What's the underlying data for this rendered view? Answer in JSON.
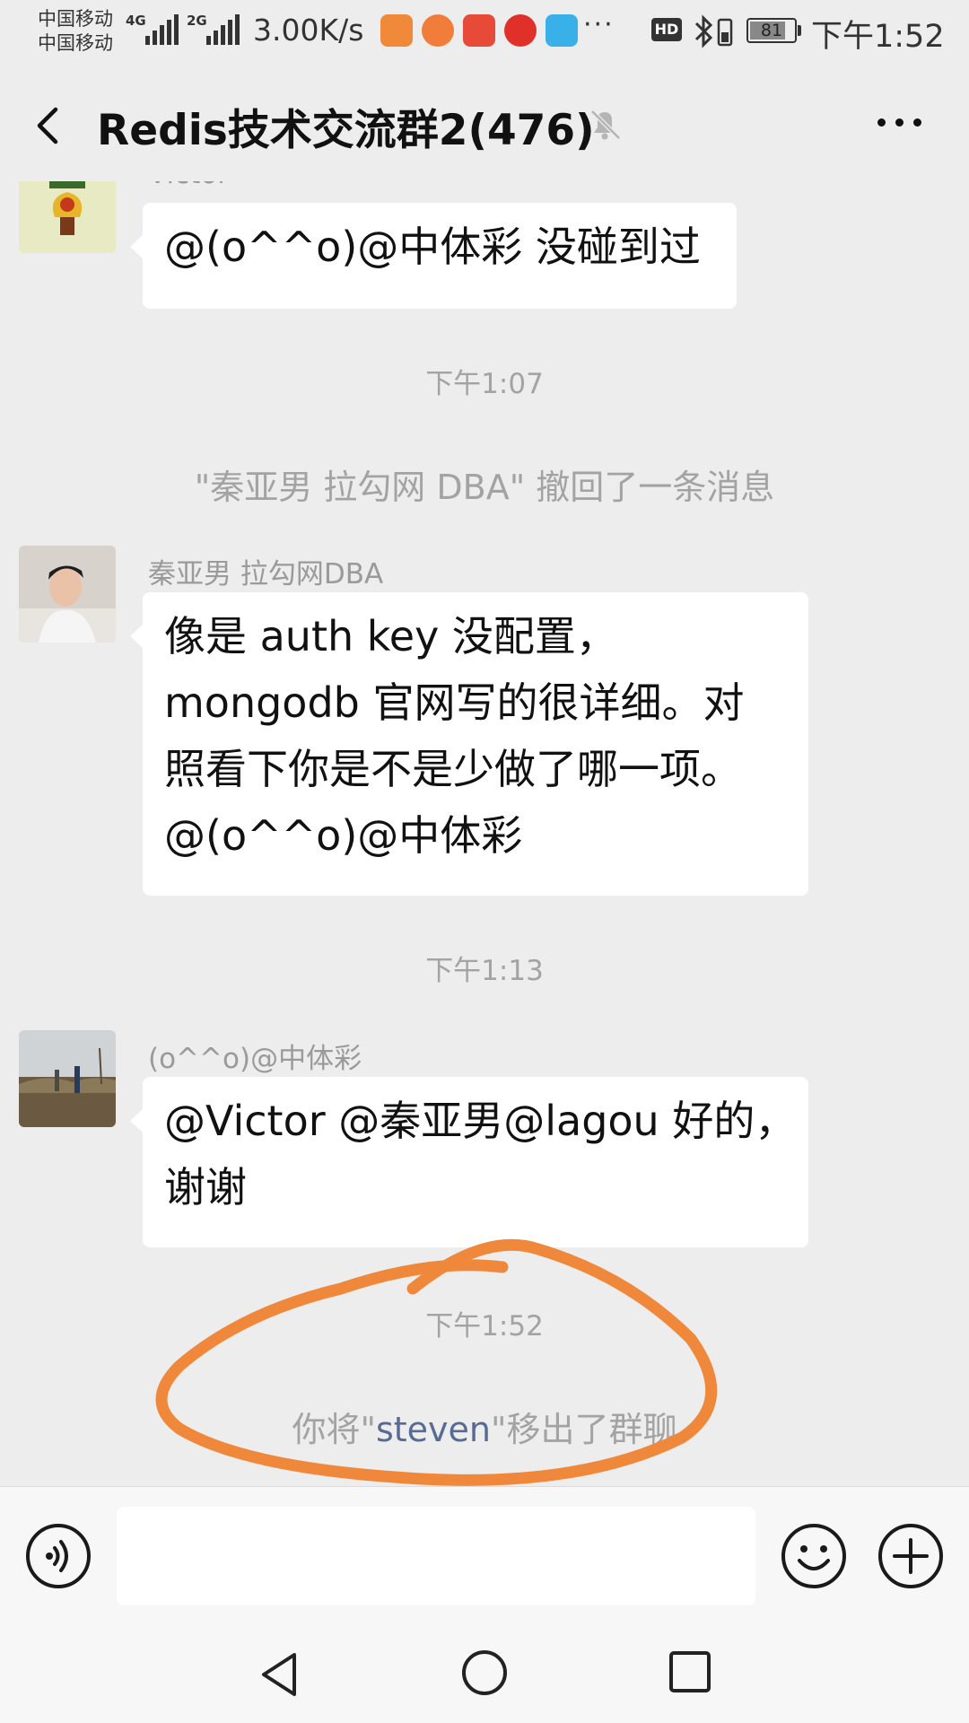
{
  "status_bar": {
    "carrier_1": "中国移动",
    "carrier_2": "中国移动",
    "net_1": "4G",
    "net_2": "2G",
    "speed": "3.00K/s",
    "more": "···",
    "hd": "HD",
    "battery": "81",
    "battery_level": 0.81,
    "time": "下午1:52",
    "app_icons": [
      "fire-app-icon",
      "squirrel-app-icon",
      "securities-app-icon",
      "netease-music-icon",
      "delivery-app-icon"
    ],
    "app_colors": [
      "#f08a3a",
      "#f27c3a",
      "#e84a3a",
      "#e0302a",
      "#3ab0e8"
    ]
  },
  "header": {
    "title": "Redis技术交流群2(476)",
    "muted": true
  },
  "messages": {
    "m1_sender": "Victor",
    "m1_text": "@(o^^o)@中体彩  没碰到过",
    "t1": "下午1:07",
    "recall": "\"秦亚男 拉勾网 DBA\" 撤回了一条消息",
    "m2_sender": "秦亚男 拉勾网DBA",
    "m2_lines": [
      "像是 auth  key 没配置，",
      "mongodb 官网写的很详细。对",
      "照看下你是不是少做了哪一项。",
      "@(o^^o)@中体彩"
    ],
    "t2": "下午1:13",
    "m3_sender": "(o^^o)@中体彩",
    "m3_lines": [
      "@Victor @秦亚男@lagou  好的，",
      "谢谢"
    ],
    "t3": "下午1:52",
    "removed_prefix": "你将\"",
    "removed_name": "steven",
    "removed_suffix": "\"移出了群聊"
  },
  "annotation_color": "#f0883c",
  "input": {
    "value": "",
    "placeholder": ""
  },
  "colors": {
    "background": "#ededed",
    "bubble": "#ffffff",
    "link": "#576b95",
    "system_text": "#a3a3a3"
  }
}
